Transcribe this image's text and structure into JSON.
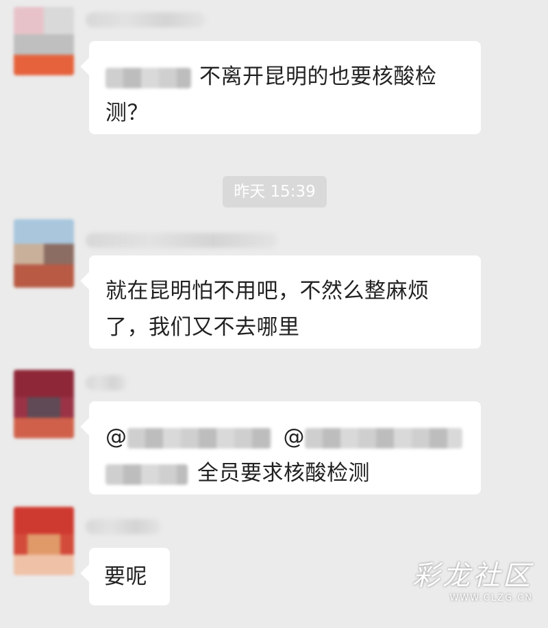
{
  "chat": {
    "messages": [
      {
        "mention_prefix": "",
        "text_line1": "不离开昆明的也要核酸检",
        "text_line2": "测？"
      },
      {
        "text_line1": "就在昆明怕不用吧，不然么整麻烦",
        "text_line2": "了，我们又不去哪里"
      },
      {
        "mention_1": "@",
        "mention_2": "@",
        "text": "全员要求核酸检测"
      },
      {
        "text": "要呢"
      }
    ],
    "timestamp": "昨天 15:39"
  },
  "watermark": {
    "title": "彩龙社区",
    "url": "WWW.CLZG.CN"
  },
  "colors": {
    "background": "#ebebeb",
    "bubble": "#ffffff",
    "timestamp_bg": "#d9d9d9"
  }
}
